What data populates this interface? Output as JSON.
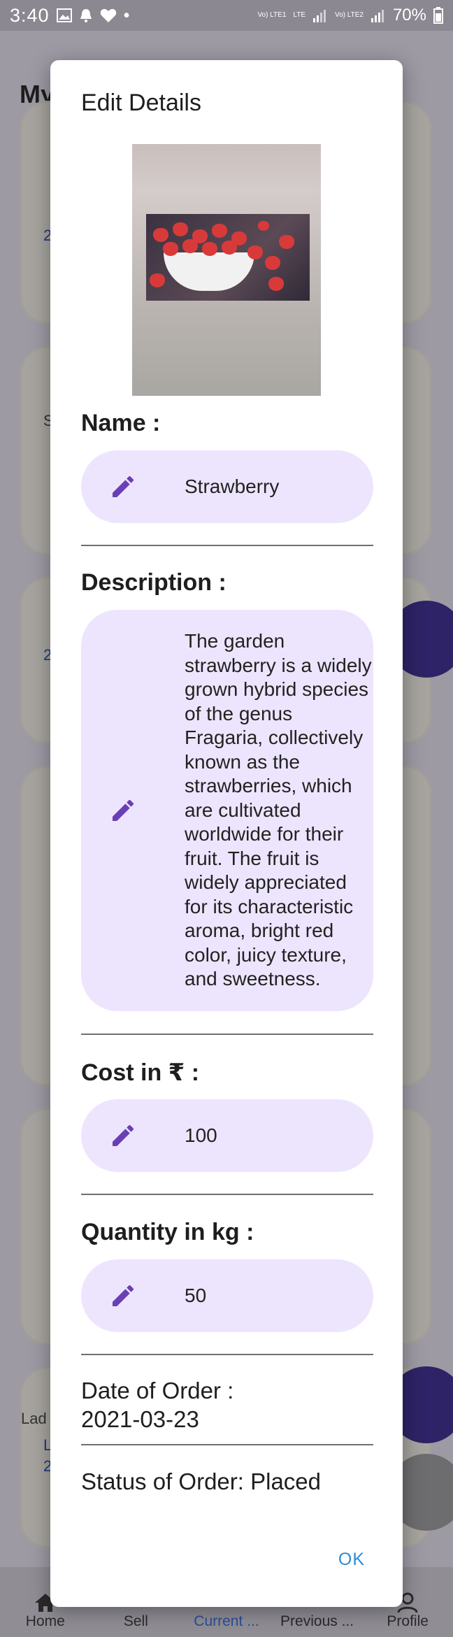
{
  "status_bar": {
    "time": "3:40",
    "battery": "70%",
    "sim1": "Vo) LTE1",
    "sim2": "Vo) LTE2",
    "lte": "LTE"
  },
  "background": {
    "page_title": "My Current Sal",
    "card_fragments": [
      "2",
      "S",
      "2",
      "Lad",
      "L",
      "2"
    ],
    "nav": [
      {
        "label": "Home",
        "icon": "home-icon"
      },
      {
        "label": "Sell",
        "icon": "sell-icon"
      },
      {
        "label": "Current ...",
        "icon": "current-icon"
      },
      {
        "label": "Previous ...",
        "icon": "previous-icon"
      },
      {
        "label": "Profile",
        "icon": "profile-icon"
      }
    ]
  },
  "dialog": {
    "title": "Edit Details",
    "image_icon": "strawberry-photo",
    "name_label": "Name :",
    "name_value": "Strawberry",
    "description_label": "Description :",
    "description_value": "The garden strawberry is a widely grown hybrid species of the genus Fragaria, collectively known as the strawberries, which are cultivated worldwide for their fruit. The fruit is widely appreciated for its characteristic aroma, bright red color, juicy texture, and sweetness.",
    "cost_label": "Cost in ₹ :",
    "cost_value": "100",
    "quantity_label": "Quantity in kg :",
    "quantity_value": "50",
    "date_label": "Date of Order :",
    "date_value": "2021-03-23",
    "status_text": "Status of Order: Placed",
    "ok_label": "OK",
    "accent_color": "#6a3fb5",
    "field_bg_color": "#ede5fd"
  }
}
